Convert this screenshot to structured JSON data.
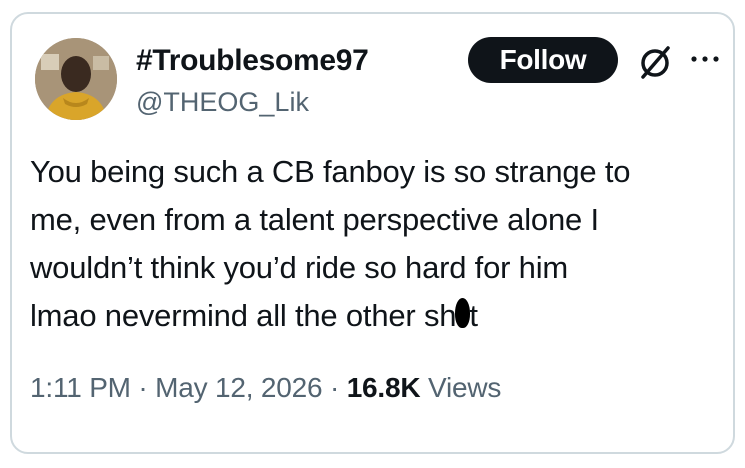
{
  "author": {
    "display_name": "#Troublesome97",
    "handle": "@THEOG_Lik",
    "avatar_icon": "user-avatar-photo"
  },
  "actions": {
    "follow_label": "Follow",
    "logo_icon": "x-logo-icon",
    "more_icon": "more-dots-icon"
  },
  "tweet": {
    "lines": [
      "You being such a CB fanboy is so strange to",
      "me, even from a talent perspective alone I",
      "wouldn’t think you’d ride so hard for him"
    ],
    "last_line_before": "lmao nevermind all the other sh",
    "last_line_after": "t"
  },
  "meta": {
    "time": "1:11 PM",
    "separator": " · ",
    "date": "May 12, 2026",
    "views_count": "16.8K",
    "views_label": " Views"
  },
  "colors": {
    "text_primary": "#0f1419",
    "text_secondary": "#536471",
    "border": "#cfd9de",
    "button_bg": "#0f1419"
  }
}
